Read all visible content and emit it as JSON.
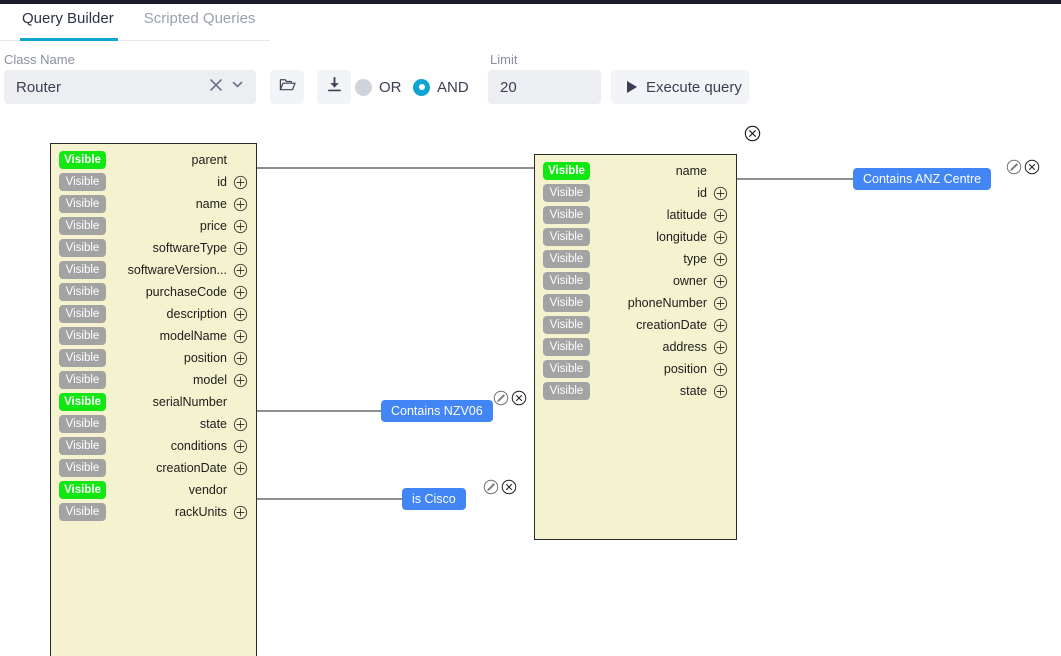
{
  "tabs": [
    {
      "label": "Query Builder",
      "active": true
    },
    {
      "label": "Scripted Queries",
      "active": false
    }
  ],
  "form": {
    "class_name_label": "Class Name",
    "class_name_value": "Router",
    "clear_icon": "close-icon",
    "dropdown_icon": "chevron-down-icon",
    "open_icon": "folder-open-icon",
    "download_icon": "download-icon",
    "operator_or_label": "OR",
    "operator_and_label": "AND",
    "operator_selected": "AND",
    "limit_label": "Limit",
    "limit_value": "20",
    "execute_label": "Execute query",
    "accent_color": "#0ea5d4",
    "chip_color": "#4285f4",
    "visible_on_color": "#13e713",
    "visible_off_color": "#a3a3a3"
  },
  "entities": [
    {
      "name": "router-entity",
      "fields": [
        {
          "visible_label": "Visible",
          "highlighted": true,
          "name": "parent",
          "has_plus": false
        },
        {
          "visible_label": "Visible",
          "highlighted": false,
          "name": "id",
          "has_plus": true
        },
        {
          "visible_label": "Visible",
          "highlighted": false,
          "name": "name",
          "has_plus": true
        },
        {
          "visible_label": "Visible",
          "highlighted": false,
          "name": "price",
          "has_plus": true
        },
        {
          "visible_label": "Visible",
          "highlighted": false,
          "name": "softwareType",
          "has_plus": true
        },
        {
          "visible_label": "Visible",
          "highlighted": false,
          "name": "softwareVersion...",
          "has_plus": true
        },
        {
          "visible_label": "Visible",
          "highlighted": false,
          "name": "purchaseCode",
          "has_plus": true
        },
        {
          "visible_label": "Visible",
          "highlighted": false,
          "name": "description",
          "has_plus": true
        },
        {
          "visible_label": "Visible",
          "highlighted": false,
          "name": "modelName",
          "has_plus": true
        },
        {
          "visible_label": "Visible",
          "highlighted": false,
          "name": "position",
          "has_plus": true
        },
        {
          "visible_label": "Visible",
          "highlighted": false,
          "name": "model",
          "has_plus": true
        },
        {
          "visible_label": "Visible",
          "highlighted": true,
          "name": "serialNumber",
          "has_plus": false
        },
        {
          "visible_label": "Visible",
          "highlighted": false,
          "name": "state",
          "has_plus": true
        },
        {
          "visible_label": "Visible",
          "highlighted": false,
          "name": "conditions",
          "has_plus": true
        },
        {
          "visible_label": "Visible",
          "highlighted": false,
          "name": "creationDate",
          "has_plus": true
        },
        {
          "visible_label": "Visible",
          "highlighted": true,
          "name": "vendor",
          "has_plus": false
        },
        {
          "visible_label": "Visible",
          "highlighted": false,
          "name": "rackUnits",
          "has_plus": true
        }
      ]
    },
    {
      "name": "site-entity",
      "fields": [
        {
          "visible_label": "Visible",
          "highlighted": true,
          "name": "name",
          "has_plus": false
        },
        {
          "visible_label": "Visible",
          "highlighted": false,
          "name": "id",
          "has_plus": true
        },
        {
          "visible_label": "Visible",
          "highlighted": false,
          "name": "latitude",
          "has_plus": true
        },
        {
          "visible_label": "Visible",
          "highlighted": false,
          "name": "longitude",
          "has_plus": true
        },
        {
          "visible_label": "Visible",
          "highlighted": false,
          "name": "type",
          "has_plus": true
        },
        {
          "visible_label": "Visible",
          "highlighted": false,
          "name": "owner",
          "has_plus": true
        },
        {
          "visible_label": "Visible",
          "highlighted": false,
          "name": "phoneNumber",
          "has_plus": true
        },
        {
          "visible_label": "Visible",
          "highlighted": false,
          "name": "creationDate",
          "has_plus": true
        },
        {
          "visible_label": "Visible",
          "highlighted": false,
          "name": "address",
          "has_plus": true
        },
        {
          "visible_label": "Visible",
          "highlighted": false,
          "name": "position",
          "has_plus": true
        },
        {
          "visible_label": "Visible",
          "highlighted": false,
          "name": "state",
          "has_plus": true
        }
      ]
    }
  ],
  "conditions": [
    {
      "label": "Contains NZV06",
      "edit_icon": "edit-icon",
      "delete_icon": "delete-icon"
    },
    {
      "label": "is Cisco",
      "edit_icon": "edit-icon",
      "delete_icon": "delete-icon"
    },
    {
      "label": "Contains ANZ Centre",
      "edit_icon": "edit-icon",
      "delete_icon": "delete-icon"
    }
  ],
  "entity_close": {
    "icon": "close-icon"
  }
}
